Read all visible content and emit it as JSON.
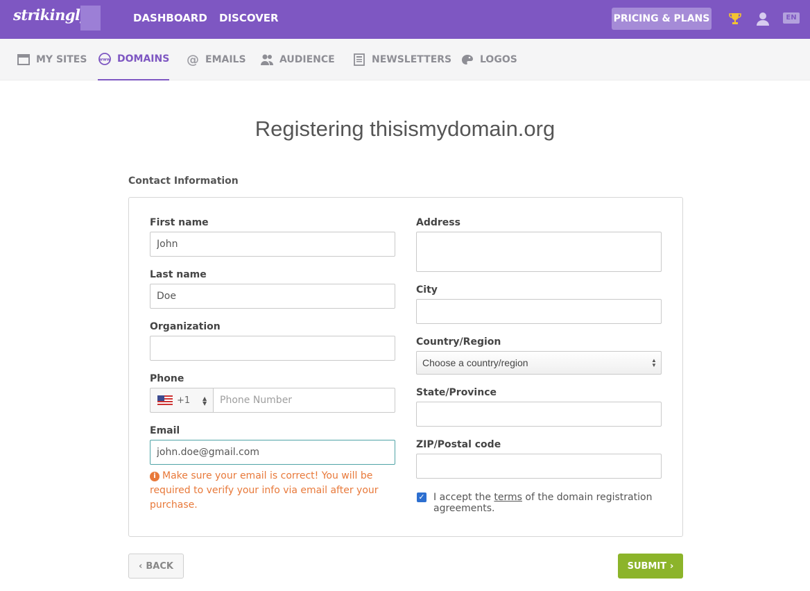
{
  "header": {
    "logo": "strikingly",
    "nav": [
      "DASHBOARD",
      "DISCOVER"
    ],
    "pricing_label": "PRICING & PLANS",
    "lang": "EN"
  },
  "subnav": {
    "items": [
      {
        "label": "MY SITES",
        "icon": "browser-icon"
      },
      {
        "label": "DOMAINS",
        "icon": "www-icon",
        "active": true
      },
      {
        "label": "EMAILS",
        "icon": "at-icon"
      },
      {
        "label": "AUDIENCE",
        "icon": "people-icon"
      },
      {
        "label": "NEWSLETTERS",
        "icon": "newsletter-icon"
      },
      {
        "label": "LOGOS",
        "icon": "palette-icon"
      }
    ]
  },
  "page": {
    "title": "Registering thisismydomain.org",
    "section_label": "Contact Information"
  },
  "form": {
    "first_name_label": "First name",
    "first_name_value": "John",
    "last_name_label": "Last name",
    "last_name_value": "Doe",
    "organization_label": "Organization",
    "organization_value": "",
    "phone_label": "Phone",
    "phone_code": "+1",
    "phone_placeholder": "Phone Number",
    "email_label": "Email",
    "email_value": "john.doe@gmail.com",
    "email_warning": "Make sure your email is correct! You will be required to verify your info via email after your purchase.",
    "address_label": "Address",
    "city_label": "City",
    "country_label": "Country/Region",
    "country_selected": "Choose a country/region",
    "state_label": "State/Province",
    "zip_label": "ZIP/Postal code",
    "terms_prefix": "I accept the",
    "terms_link": "terms",
    "terms_suffix": "of the domain registration agreements.",
    "terms_checked": true
  },
  "actions": {
    "back_label": "BACK",
    "submit_label": "SUBMIT"
  },
  "colors": {
    "brand_purple": "#7e57c2",
    "submit_green": "#8cb42a",
    "warning_orange": "#e8793a"
  }
}
